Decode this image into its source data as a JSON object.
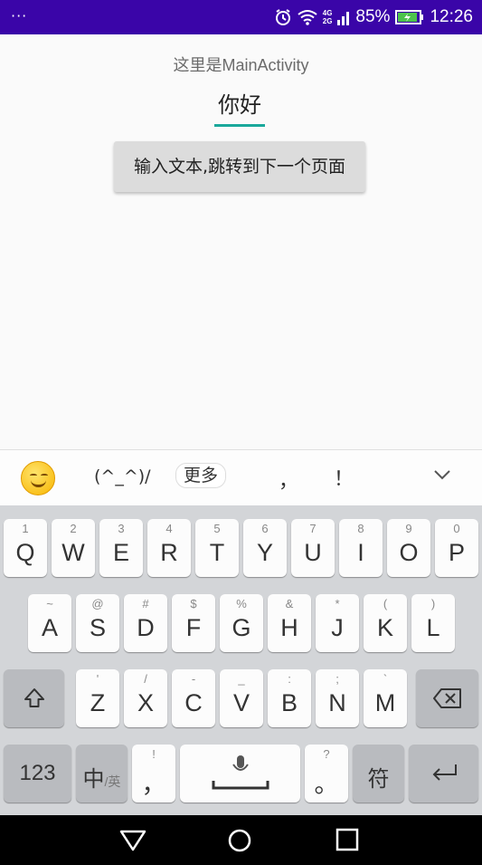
{
  "status_bar": {
    "left_dots": "···",
    "network_top": "4G",
    "network_bottom": "2G",
    "battery": "85%",
    "time": "12:26"
  },
  "app": {
    "title": "这里是MainActivity",
    "input_value": "你好",
    "button_label": "输入文本,跳转到下一个页面"
  },
  "candidate_bar": {
    "emoji": "smiley-emoji",
    "kaomoji": "(^_^)/",
    "more_label": "更多",
    "comma": "，",
    "exclamation": "！"
  },
  "keyboard": {
    "row1": [
      {
        "main": "Q",
        "hint": "1"
      },
      {
        "main": "W",
        "hint": "2"
      },
      {
        "main": "E",
        "hint": "3"
      },
      {
        "main": "R",
        "hint": "4"
      },
      {
        "main": "T",
        "hint": "5"
      },
      {
        "main": "Y",
        "hint": "6"
      },
      {
        "main": "U",
        "hint": "7"
      },
      {
        "main": "I",
        "hint": "8"
      },
      {
        "main": "O",
        "hint": "9"
      },
      {
        "main": "P",
        "hint": "0"
      }
    ],
    "row2": [
      {
        "main": "A",
        "hint": "~"
      },
      {
        "main": "S",
        "hint": "@"
      },
      {
        "main": "D",
        "hint": "#"
      },
      {
        "main": "F",
        "hint": "$"
      },
      {
        "main": "G",
        "hint": "%"
      },
      {
        "main": "H",
        "hint": "&"
      },
      {
        "main": "J",
        "hint": "*"
      },
      {
        "main": "K",
        "hint": "("
      },
      {
        "main": "L",
        "hint": ")"
      }
    ],
    "row3": [
      {
        "main": "Z",
        "hint": "'"
      },
      {
        "main": "X",
        "hint": "/"
      },
      {
        "main": "C",
        "hint": "-"
      },
      {
        "main": "V",
        "hint": "_"
      },
      {
        "main": "B",
        "hint": ":"
      },
      {
        "main": "N",
        "hint": ";"
      },
      {
        "main": "M",
        "hint": "`"
      }
    ],
    "numbers_label": "123",
    "lang_main": "中",
    "lang_sub": "/英",
    "comma_key": "，",
    "comma_hint": "!",
    "period_key": "。",
    "period_hint": "?",
    "symbol_label": "符"
  },
  "colors": {
    "status_bar": "#3a05a8",
    "accent": "#1aa89b",
    "keyboard_bg": "#d3d5d8"
  }
}
